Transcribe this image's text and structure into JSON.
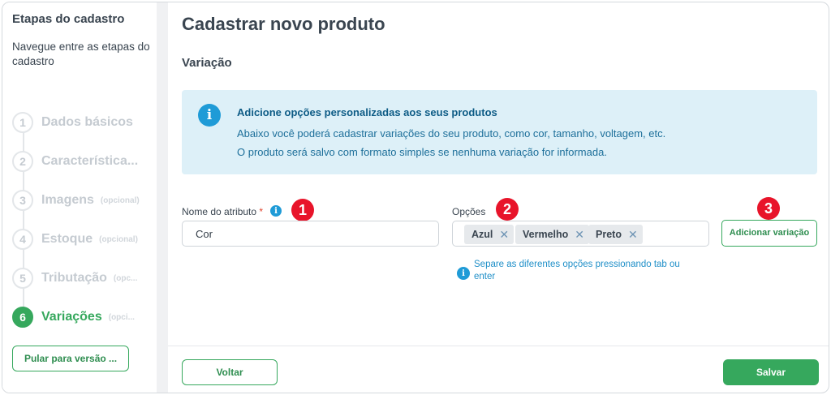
{
  "sidebar": {
    "title": "Etapas do cadastro",
    "description": "Navegue entre as etapas do cadastro",
    "steps": [
      {
        "number": "1",
        "label": "Dados básicos",
        "optional": ""
      },
      {
        "number": "2",
        "label": "Característica...",
        "optional": ""
      },
      {
        "number": "3",
        "label": "Imagens",
        "optional": "(opcional)"
      },
      {
        "number": "4",
        "label": "Estoque",
        "optional": "(opcional)"
      },
      {
        "number": "5",
        "label": "Tributação",
        "optional": "(opc..."
      },
      {
        "number": "6",
        "label": "Variações",
        "optional": "(opci..."
      }
    ],
    "active_step": "6",
    "skip_button": "Pular para versão ..."
  },
  "main": {
    "title": "Cadastrar novo produto",
    "section_title": "Variação",
    "info_box": {
      "icon": "info-icon",
      "title": "Adicione opções personalizadas aos seus produtos",
      "line1": "Abaixo você poderá cadastrar variações do seu produto, como cor, tamanho, voltagem, etc.",
      "line2": "O produto será salvo com formato simples se nenhuma variação for informada."
    },
    "attribute": {
      "label": "Nome do atributo",
      "required_mark": "*",
      "value": "Cor"
    },
    "options": {
      "label": "Opções",
      "chips": [
        "Azul",
        "Vermelho",
        "Preto"
      ],
      "chip_remove": "✕",
      "hint": "Separe as diferentes opções pressionando tab ou enter"
    },
    "add_variation_button": "Adicionar variação",
    "badges": [
      "1",
      "2",
      "3"
    ],
    "footer": {
      "back_button": "Voltar",
      "save_button": "Salvar"
    }
  },
  "colors": {
    "accent_green": "#36a85d",
    "info_blue": "#1f9bd7",
    "info_bg": "#ddf0f8",
    "badge_red": "#e8142a"
  }
}
